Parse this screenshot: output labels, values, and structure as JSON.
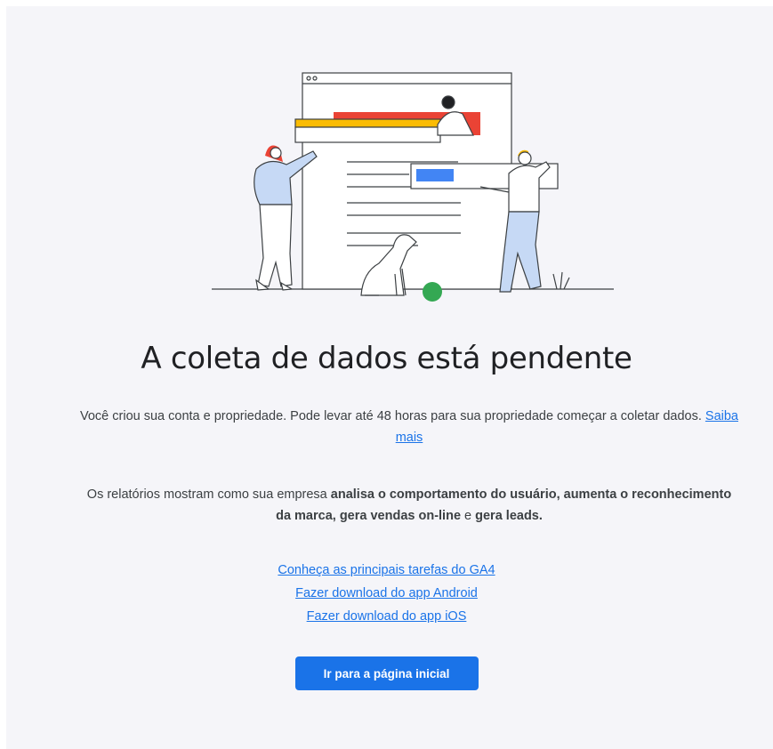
{
  "title": "A coleta de dados está pendente",
  "intro": {
    "text": "Você criou sua conta e propriedade. Pode levar até 48 horas para sua propriedade começar a coletar dados.",
    "link_label": "Saiba mais"
  },
  "reports": {
    "prefix": "Os relatórios mostram como sua empresa ",
    "bold1": "analisa o comportamento do usuário, aumenta o reconhecimento da marca, gera vendas on-line",
    "middle": " e ",
    "bold2": "gera leads."
  },
  "links": [
    "Conheça as principais tarefas do GA4",
    "Fazer download do app Android",
    "Fazer download do app iOS"
  ],
  "button": {
    "label": "Ir para a página inicial"
  },
  "colors": {
    "accent": "#1a73e8",
    "background": "#f5f5f9",
    "illustration_red": "#ea4335",
    "illustration_yellow": "#fbbc04",
    "illustration_blue": "#4285f4",
    "illustration_green": "#34a853"
  },
  "illustration": {
    "icon": "people-building-webpage-illustration"
  }
}
